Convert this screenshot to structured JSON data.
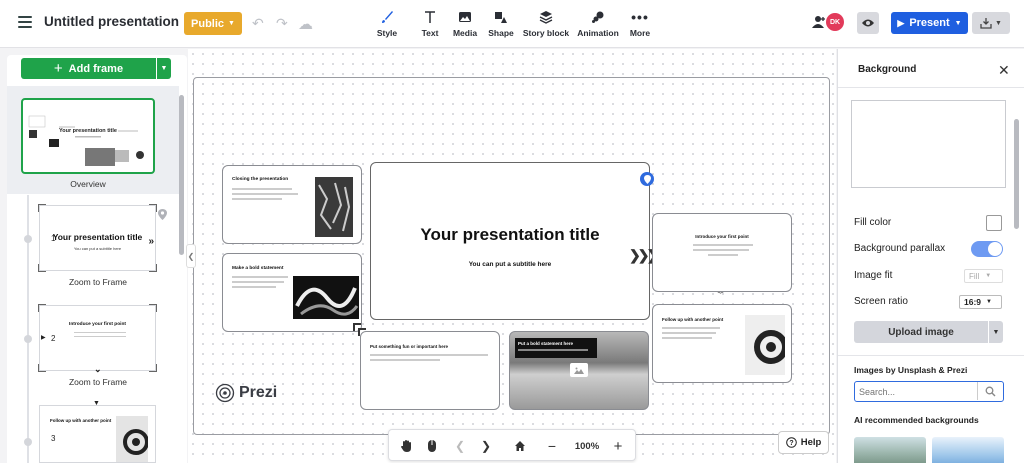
{
  "header": {
    "title": "Untitled presentation",
    "public_label": "Public",
    "avatar_initials": "DK",
    "present_label": "Present"
  },
  "toolbar": [
    {
      "label": "Style",
      "icon": "brush-icon"
    },
    {
      "label": "Text",
      "icon": "text-icon"
    },
    {
      "label": "Media",
      "icon": "image-icon"
    },
    {
      "label": "Shape",
      "icon": "shape-icon"
    },
    {
      "label": "Story block",
      "icon": "layers-icon"
    },
    {
      "label": "Animation",
      "icon": "animation-icon"
    },
    {
      "label": "More",
      "icon": "more-icon"
    }
  ],
  "left_panel": {
    "add_frame_label": "Add frame",
    "overview_label": "Overview",
    "frames": [
      {
        "number": "1",
        "title": "Your presentation title",
        "subtitle": "You can put a subtitle here",
        "caption": "Zoom to Frame"
      },
      {
        "number": "2",
        "title": "Introduce your first point",
        "caption": "Zoom to Frame"
      },
      {
        "number": "3",
        "title": "Follow up with another point"
      }
    ]
  },
  "canvas": {
    "main_title": "Your presentation title",
    "main_subtitle": "You can put a subtitle here",
    "closing_title": "Closing the presentation",
    "bold_statement_title": "Make a bold statement",
    "fun_title": "Put something fun or important here",
    "bold_banner_title": "Put a bold statement here",
    "intro_title": "Introduce your first point",
    "follow_title": "Follow up with another point",
    "logo_text": "Prezi"
  },
  "bottom_bar": {
    "zoom": "100%",
    "help_label": "Help"
  },
  "right_panel": {
    "title": "Background",
    "fill_color_label": "Fill color",
    "parallax_label": "Background parallax",
    "image_fit_label": "Image fit",
    "image_fit_value": "Fill",
    "screen_ratio_label": "Screen ratio",
    "screen_ratio_value": "16:9",
    "upload_label": "Upload image",
    "unsplash_label": "Images by Unsplash & Prezi",
    "search_placeholder": "Search...",
    "ai_label": "AI recommended backgrounds"
  },
  "colors": {
    "accent_green": "#1fa34a",
    "present_blue": "#1f5fe0",
    "public_yellow": "#e8a92c",
    "avatar_red": "#e23a5a"
  }
}
